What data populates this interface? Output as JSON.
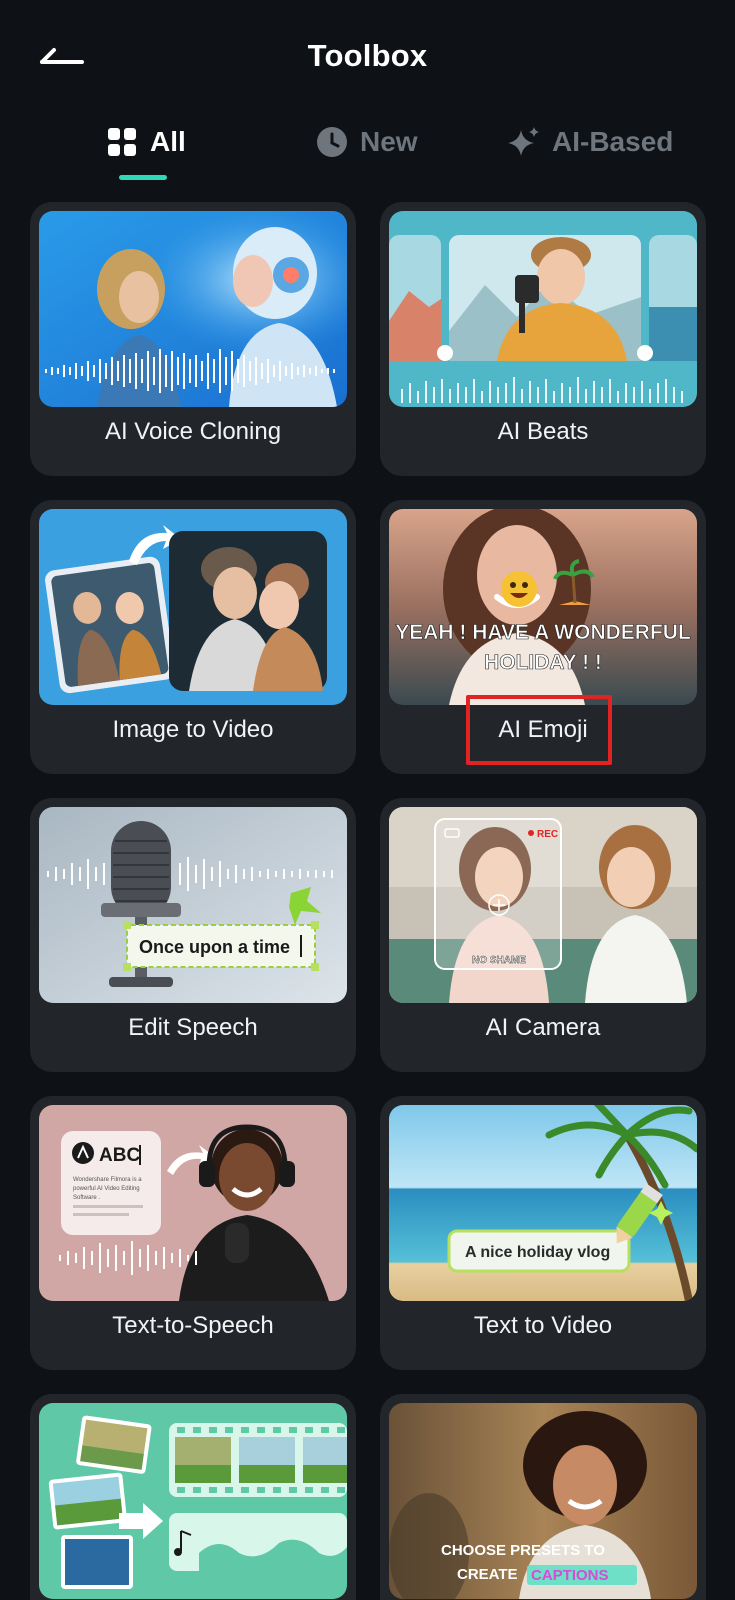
{
  "header": {
    "title": "Toolbox"
  },
  "tabs": [
    {
      "label": "All",
      "icon": "grid-icon",
      "active": true
    },
    {
      "label": "New",
      "icon": "clock-icon",
      "active": false
    },
    {
      "label": "AI-Based",
      "icon": "sparkle-icon",
      "active": false
    }
  ],
  "accent_color": "#2fd9b7",
  "highlight_color": "#e02424",
  "cards": [
    {
      "label": "AI Voice Cloning"
    },
    {
      "label": "AI Beats"
    },
    {
      "label": "Image to Video"
    },
    {
      "label": "AI Emoji",
      "thumb_text_1": "YEAH ! HAVE A WONDERFUL",
      "thumb_text_2": "HOLIDAY ! !",
      "highlighted": true
    },
    {
      "label": "Edit Speech",
      "thumb_text": "Once upon a time"
    },
    {
      "label": "AI Camera",
      "thumb_rec": "REC",
      "thumb_tag": "NO SHAME"
    },
    {
      "label": "Text-to-Speech",
      "thumb_text": "ABC",
      "thumb_desc_1": "Wondershare Filmora is a",
      "thumb_desc_2": "powerful AI Video Editing",
      "thumb_desc_3": "Software ."
    },
    {
      "label": "Text to Video",
      "thumb_text": "A nice holiday vlog"
    },
    {
      "label": ""
    },
    {
      "label": "",
      "thumb_text_1": "CHOOSE PRESETS TO",
      "thumb_text_2a": "CREATE",
      "thumb_text_2b": "CAPTIONS"
    }
  ]
}
